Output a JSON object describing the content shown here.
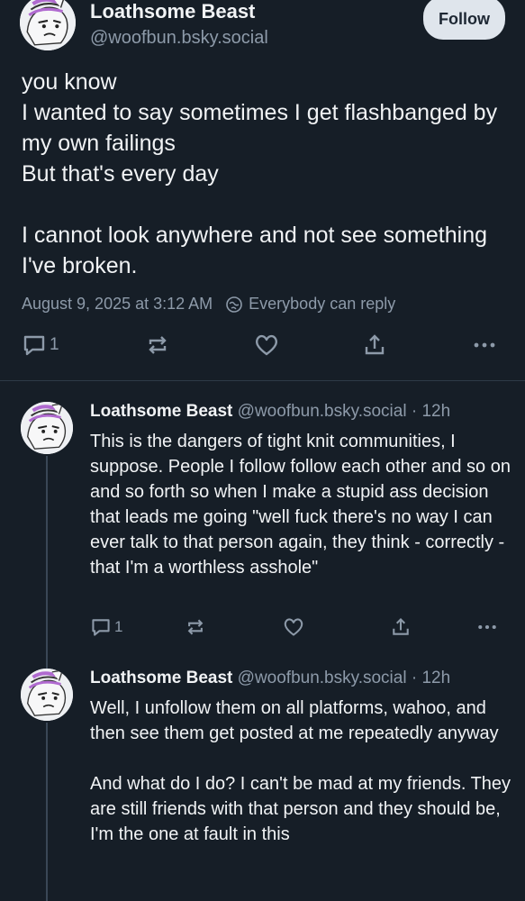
{
  "main_post": {
    "author_name": "Loathsome Beast",
    "author_handle": "@woofbun.bsky.social",
    "follow_label": "Follow",
    "text_lines": [
      "you know",
      "I wanted to say sometimes I get flashbanged by my own failings",
      "But that's every day",
      "",
      "I cannot look anywhere and not see something I've broken."
    ],
    "timestamp": "August 9, 2025 at 3:12 AM",
    "reply_setting": "Everybody can reply",
    "reply_count": "1"
  },
  "replies": [
    {
      "author_name": "Loathsome Beast",
      "author_handle": "@woofbun.bsky.social",
      "time_ago": "12h",
      "separator": "·",
      "text_paragraphs": [
        "This is the dangers of tight knit communities, I suppose. People I follow follow each other and so on and so forth so when I make a stupid ass decision that leads me going \"well fuck there's no way I can ever talk to that person again, they think - correctly - that I'm a worthless asshole\""
      ],
      "reply_count": "1"
    },
    {
      "author_name": "Loathsome Beast",
      "author_handle": "@woofbun.bsky.social",
      "time_ago": "12h",
      "separator": "·",
      "text_paragraphs": [
        "Well, I unfollow them on all platforms, wahoo, and then see them get posted at me repeatedly anyway",
        "",
        "And what do I do? I can't be mad at my friends. They are still friends with that person and they should be, I'm the one at fault in this"
      ]
    }
  ],
  "colors": {
    "background": "#161e27",
    "text": "#f1f3f5",
    "muted": "#8d9aa9",
    "follow_bg": "#dfe5ec"
  },
  "icons": [
    "avatar-pony-icon",
    "comment-icon",
    "repost-icon",
    "heart-icon",
    "share-icon",
    "more-icon",
    "globe-reply-icon"
  ]
}
